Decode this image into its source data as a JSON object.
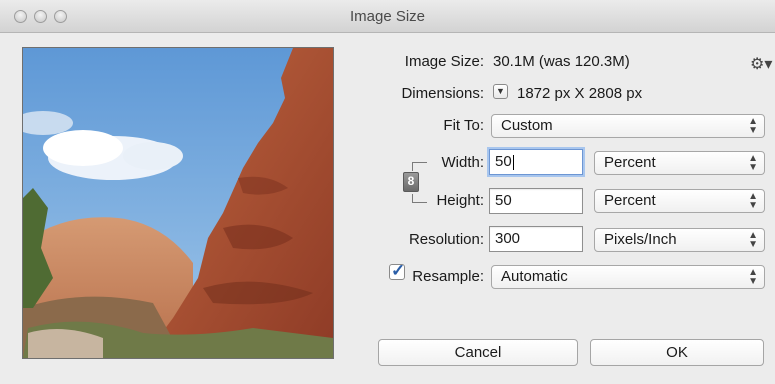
{
  "window": {
    "title": "Image Size"
  },
  "info": {
    "image_size_label": "Image Size:",
    "image_size_value": "30.1M (was 120.3M)",
    "dimensions_label": "Dimensions:",
    "dimensions_value": "1872 px  X  2808 px"
  },
  "fit_to": {
    "label": "Fit To:",
    "value": "Custom"
  },
  "width": {
    "label": "Width:",
    "value": "50",
    "unit": "Percent"
  },
  "height": {
    "label": "Height:",
    "value": "50",
    "unit": "Percent"
  },
  "resolution": {
    "label": "Resolution:",
    "value": "300",
    "unit": "Pixels/Inch"
  },
  "resample": {
    "label": "Resample:",
    "checked": true,
    "value": "Automatic"
  },
  "buttons": {
    "cancel": "Cancel",
    "ok": "OK"
  },
  "icons": {
    "gear": "gear-icon",
    "link": "chain-link-icon",
    "disclosure": "disclosure-triangle-icon",
    "select_arrows": "up-down-arrows-icon"
  },
  "colors": {
    "focus_ring": "#a8c6ee",
    "sky": "#7fb0e0",
    "rock": "#b4583a"
  }
}
